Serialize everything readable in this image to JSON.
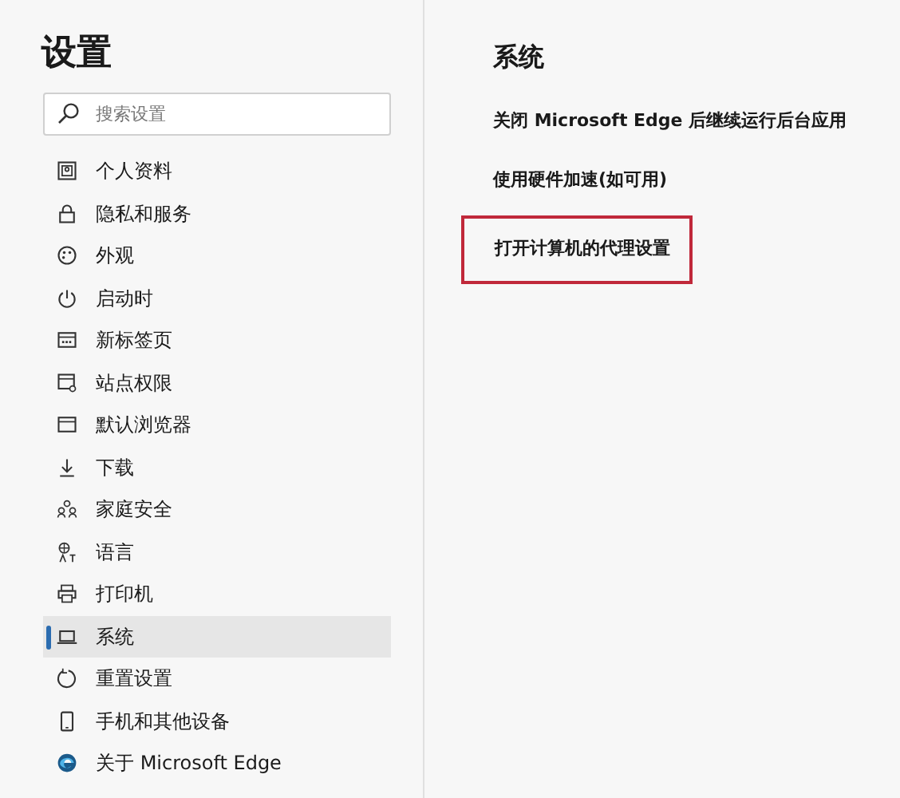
{
  "sidebar": {
    "title": "设置",
    "search": {
      "placeholder": "搜索设置"
    },
    "items": [
      {
        "label": "个人资料",
        "selected": false
      },
      {
        "label": "隐私和服务",
        "selected": false
      },
      {
        "label": "外观",
        "selected": false
      },
      {
        "label": "启动时",
        "selected": false
      },
      {
        "label": "新标签页",
        "selected": false
      },
      {
        "label": "站点权限",
        "selected": false
      },
      {
        "label": "默认浏览器",
        "selected": false
      },
      {
        "label": "下载",
        "selected": false
      },
      {
        "label": "家庭安全",
        "selected": false
      },
      {
        "label": "语言",
        "selected": false
      },
      {
        "label": "打印机",
        "selected": false
      },
      {
        "label": "系统",
        "selected": true
      },
      {
        "label": "重置设置",
        "selected": false
      },
      {
        "label": "手机和其他设备",
        "selected": false
      },
      {
        "label": "关于 Microsoft Edge",
        "selected": false
      }
    ]
  },
  "content": {
    "title": "系统",
    "settings": [
      {
        "label": "关闭 Microsoft Edge 后继续运行后台应用",
        "highlighted": false
      },
      {
        "label": "使用硬件加速(如可用)",
        "highlighted": false
      },
      {
        "label": "打开计算机的代理设置",
        "highlighted": true
      }
    ]
  }
}
